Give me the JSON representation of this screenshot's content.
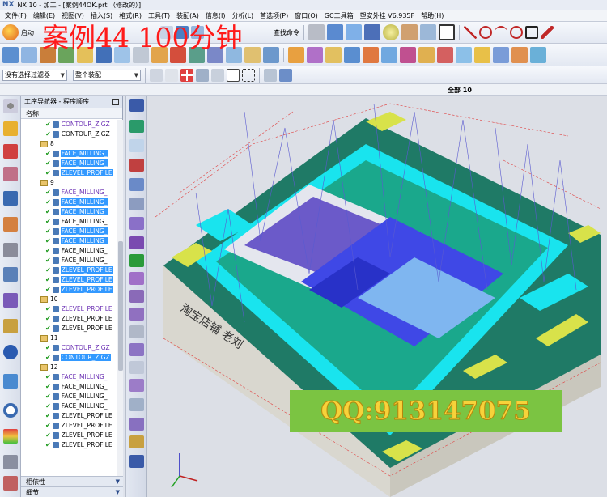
{
  "window": {
    "logo": "NX",
    "title": "NX 10 - 加工 - [案例44OK.prt （修改的）]"
  },
  "menu": [
    "文件(F)",
    "编辑(E)",
    "视图(V)",
    "插入(S)",
    "格式(R)",
    "工具(T)",
    "装配(A)",
    "信息(I)",
    "分析(L)",
    "首选项(P)",
    "窗口(O)",
    "GC工具箱",
    "塑安外挂 V6.935F",
    "帮助(H)"
  ],
  "toolbar": {
    "start_label": "启动",
    "find_cmd_label": "查找命令",
    "filter_combo": "没有选择过滤器",
    "assembly_combo": "整个装配"
  },
  "overlay": {
    "watermark": "案例44 100分钟",
    "qq": "QQ:913147075"
  },
  "viewport": {
    "view_label": "全部 10",
    "engraving": "淘宝店铺 老刘"
  },
  "navigator": {
    "title": "工序导航器 - 程序顺序",
    "column": "名称",
    "rows": [
      {
        "indent": 1,
        "type": "op",
        "label": "CONTOUR_ZIGZ",
        "style": "pur"
      },
      {
        "indent": 1,
        "type": "op",
        "label": "CONTOUR_ZIGZ",
        "style": ""
      },
      {
        "indent": 0,
        "type": "group",
        "label": "8",
        "style": ""
      },
      {
        "indent": 1,
        "type": "op",
        "label": "FACE_MILLING_",
        "style": "sel"
      },
      {
        "indent": 1,
        "type": "op",
        "label": "FACE_MILLING_",
        "style": "sel"
      },
      {
        "indent": 1,
        "type": "op",
        "label": "ZLEVEL_PROFILE",
        "style": "sel"
      },
      {
        "indent": 0,
        "type": "group",
        "label": "9",
        "style": ""
      },
      {
        "indent": 1,
        "type": "op",
        "label": "FACE_MILLING_",
        "style": "pur"
      },
      {
        "indent": 1,
        "type": "op",
        "label": "FACE_MILLING_",
        "style": "sel"
      },
      {
        "indent": 1,
        "type": "op",
        "label": "FACE_MILLING_",
        "style": "sel"
      },
      {
        "indent": 1,
        "type": "op",
        "label": "FACE_MILLING_",
        "style": ""
      },
      {
        "indent": 1,
        "type": "op",
        "label": "FACE_MILLING_",
        "style": "sel"
      },
      {
        "indent": 1,
        "type": "op",
        "label": "FACE_MILLING_",
        "style": "sel"
      },
      {
        "indent": 1,
        "type": "op",
        "label": "FACE_MILLING_",
        "style": ""
      },
      {
        "indent": 1,
        "type": "op",
        "label": "FACE_MILLING_",
        "style": ""
      },
      {
        "indent": 1,
        "type": "op",
        "label": "ZLEVEL_PROFILE",
        "style": "sel"
      },
      {
        "indent": 1,
        "type": "op",
        "label": "ZLEVEL_PROFILE",
        "style": "sel"
      },
      {
        "indent": 1,
        "type": "op",
        "label": "ZLEVEL_PROFILE",
        "style": "sel"
      },
      {
        "indent": 0,
        "type": "group",
        "label": "10",
        "style": ""
      },
      {
        "indent": 1,
        "type": "op",
        "label": "ZLEVEL_PROFILE",
        "style": "pur"
      },
      {
        "indent": 1,
        "type": "op",
        "label": "ZLEVEL_PROFILE",
        "style": ""
      },
      {
        "indent": 1,
        "type": "op",
        "label": "ZLEVEL_PROFILE",
        "style": ""
      },
      {
        "indent": 0,
        "type": "group",
        "label": "11",
        "style": ""
      },
      {
        "indent": 1,
        "type": "op",
        "label": "CONTOUR_ZIGZ",
        "style": "pur"
      },
      {
        "indent": 1,
        "type": "op",
        "label": "CONTOUR_ZIGZ",
        "style": "sel"
      },
      {
        "indent": 0,
        "type": "group",
        "label": "12",
        "style": ""
      },
      {
        "indent": 1,
        "type": "op",
        "label": "FACE_MILLING_",
        "style": "pur"
      },
      {
        "indent": 1,
        "type": "op",
        "label": "FACE_MILLING_",
        "style": ""
      },
      {
        "indent": 1,
        "type": "op",
        "label": "FACE_MILLING_",
        "style": ""
      },
      {
        "indent": 1,
        "type": "op",
        "label": "FACE_MILLING_",
        "style": ""
      },
      {
        "indent": 1,
        "type": "op",
        "label": "ZLEVEL_PROFILE",
        "style": ""
      },
      {
        "indent": 1,
        "type": "op",
        "label": "ZLEVEL_PROFILE",
        "style": ""
      },
      {
        "indent": 1,
        "type": "op",
        "label": "ZLEVEL_PROFILE",
        "style": ""
      },
      {
        "indent": 1,
        "type": "op",
        "label": "ZLEVEL_PROFILE",
        "style": ""
      }
    ],
    "panels": [
      "相依性",
      "细节"
    ]
  },
  "colors": {
    "cyan": "#19e4ee",
    "dark_green": "#1f7a66",
    "yellow": "#d8e24a",
    "blue": "#3f48e6",
    "selection": "#3399ff",
    "watermark_red": "#ff1a1a",
    "qq_bg": "#7bc442",
    "qq_text": "#f7d23a"
  }
}
